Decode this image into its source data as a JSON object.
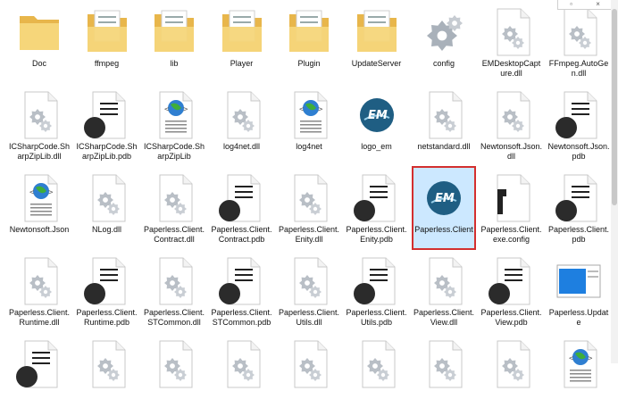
{
  "window_controls": {
    "restore_glyph": "▫",
    "close_glyph": "×"
  },
  "files": [
    {
      "name": "Doc",
      "type": "folder-plain",
      "selected": false
    },
    {
      "name": "ffmpeg",
      "type": "folder-docs",
      "selected": false
    },
    {
      "name": "lib",
      "type": "folder-docs",
      "selected": false
    },
    {
      "name": "Player",
      "type": "folder-docs",
      "selected": false
    },
    {
      "name": "Plugin",
      "type": "folder-docs",
      "selected": false
    },
    {
      "name": "UpdateServer",
      "type": "folder-docs",
      "selected": false
    },
    {
      "name": "config",
      "type": "gear",
      "selected": false
    },
    {
      "name": "EMDesktopCapture.dll",
      "type": "dll",
      "selected": false
    },
    {
      "name": "FFmpeg.AutoGen.dll",
      "type": "dll",
      "selected": false
    },
    {
      "name": "ICSharpCode.SharpZipLib.dll",
      "type": "dll",
      "selected": false
    },
    {
      "name": "ICSharpCode.SharpZipLib.pdb",
      "type": "pdb",
      "selected": false
    },
    {
      "name": "ICSharpCode.SharpZipLib",
      "type": "xml",
      "selected": false
    },
    {
      "name": "log4net.dll",
      "type": "dll",
      "selected": false
    },
    {
      "name": "log4net",
      "type": "xml",
      "selected": false
    },
    {
      "name": "logo_em",
      "type": "logo",
      "selected": false
    },
    {
      "name": "netstandard.dll",
      "type": "dll",
      "selected": false
    },
    {
      "name": "Newtonsoft.Json.dll",
      "type": "dll",
      "selected": false
    },
    {
      "name": "Newtonsoft.Json.pdb",
      "type": "pdb",
      "selected": false
    },
    {
      "name": "Newtonsoft.Json",
      "type": "xml",
      "selected": false
    },
    {
      "name": "NLog.dll",
      "type": "dll",
      "selected": false
    },
    {
      "name": "Paperless.Client.Contract.dll",
      "type": "dll",
      "selected": false
    },
    {
      "name": "Paperless.Client.Contract.pdb",
      "type": "pdb",
      "selected": false
    },
    {
      "name": "Paperless.Client.Enity.dll",
      "type": "dll",
      "selected": false
    },
    {
      "name": "Paperless.Client.Enity.pdb",
      "type": "pdb",
      "selected": false
    },
    {
      "name": "Paperless.Client",
      "type": "logo",
      "selected": true
    },
    {
      "name": "Paperless.Client.exe.config",
      "type": "config",
      "selected": false
    },
    {
      "name": "Paperless.Client.pdb",
      "type": "pdb",
      "selected": false
    },
    {
      "name": "Paperless.Client.Runtime.dll",
      "type": "dll",
      "selected": false
    },
    {
      "name": "Paperless.Client.Runtime.pdb",
      "type": "pdb",
      "selected": false
    },
    {
      "name": "Paperless.Client.STCommon.dll",
      "type": "dll",
      "selected": false
    },
    {
      "name": "Paperless.Client.STCommon.pdb",
      "type": "pdb",
      "selected": false
    },
    {
      "name": "Paperless.Client.Utils.dll",
      "type": "dll",
      "selected": false
    },
    {
      "name": "Paperless.Client.Utils.pdb",
      "type": "pdb",
      "selected": false
    },
    {
      "name": "Paperless.Client.View.dll",
      "type": "dll",
      "selected": false
    },
    {
      "name": "Paperless.Client.View.pdb",
      "type": "pdb",
      "selected": false
    },
    {
      "name": "Paperless.Update",
      "type": "app-window",
      "selected": false
    },
    {
      "name": "",
      "type": "pdb",
      "selected": false
    },
    {
      "name": "",
      "type": "dll",
      "selected": false
    },
    {
      "name": "",
      "type": "dll",
      "selected": false
    },
    {
      "name": "",
      "type": "dll",
      "selected": false
    },
    {
      "name": "",
      "type": "dll",
      "selected": false
    },
    {
      "name": "",
      "type": "dll",
      "selected": false
    },
    {
      "name": "",
      "type": "dll",
      "selected": false
    },
    {
      "name": "",
      "type": "dll",
      "selected": false
    },
    {
      "name": "",
      "type": "xml",
      "selected": false
    }
  ],
  "colors": {
    "folder": "#f6d67a",
    "folder_dark": "#e8b64b",
    "doc_fill": "#ffffff",
    "doc_border": "#c9c9c9",
    "gear": "#b9bfc6",
    "pdb_circle": "#2b2b2b",
    "logo_blue": "#1f5e83",
    "selection_bg": "#cce8ff",
    "selection_border": "#d32f2f"
  }
}
